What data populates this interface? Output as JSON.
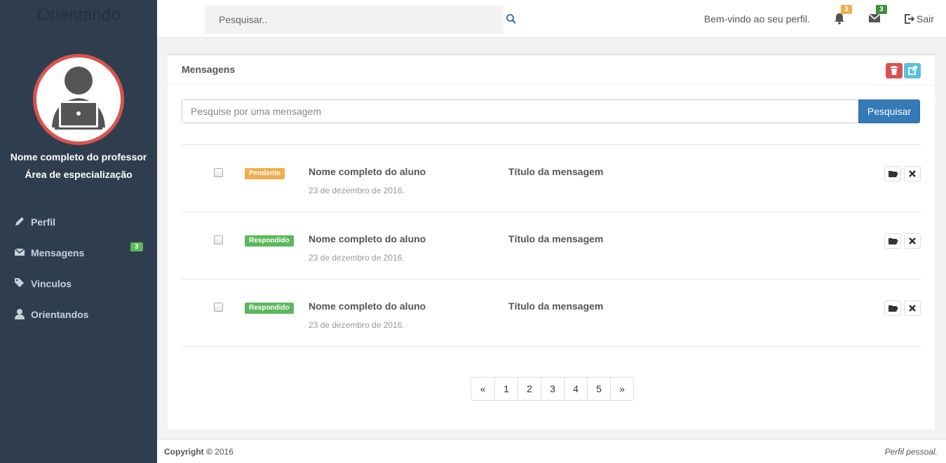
{
  "sidebar": {
    "brand": "Orientando",
    "professor_name": "Nome completo do professor",
    "professor_area": "Área de especialização",
    "items": [
      {
        "label": "Perfil",
        "icon": "pencil-icon"
      },
      {
        "label": "Mensagens",
        "icon": "envelope-icon",
        "badge": "3"
      },
      {
        "label": "Vinculos",
        "icon": "tags-icon"
      },
      {
        "label": "Orientandos",
        "icon": "user-icon"
      }
    ]
  },
  "topbar": {
    "search_placeholder": "Pesquisar..",
    "welcome": "Bem-vindo ao seu perfil.",
    "notifications_count": "3",
    "messages_count": "3",
    "logout_label": "Sair"
  },
  "panel": {
    "title": "Mensagens",
    "search_placeholder": "Pesquise por uma mensagem",
    "search_button": "Pesquisar",
    "messages": [
      {
        "status": "Pendente",
        "status_color": "#f0ad4e",
        "author": "Nome completo do aluno",
        "date": "23 de dezembro de 2016.",
        "title": "Título da mensagem"
      },
      {
        "status": "Respondido",
        "status_color": "#5cb85c",
        "author": "Nome completo do aluno",
        "date": "23 de dezembro de 2016.",
        "title": "Título da mensagem"
      },
      {
        "status": "Respondido",
        "status_color": "#5cb85c",
        "author": "Nome completo do aluno",
        "date": "23 de dezembro de 2016.",
        "title": "Título da mensagem"
      }
    ],
    "pagination": [
      "«",
      "1",
      "2",
      "3",
      "4",
      "5",
      "»"
    ]
  },
  "footer": {
    "copyright_label": "Copyright ©",
    "copyright_year": "2016",
    "right_text": "Perfil pessoal."
  },
  "colors": {
    "sidebar_bg": "#2f3e4e",
    "avatar_ring": "#d9534f",
    "primary": "#337ab7",
    "warning": "#f0ad4e",
    "success": "#5cb85c",
    "danger": "#d9534f",
    "info": "#5bc0de"
  }
}
